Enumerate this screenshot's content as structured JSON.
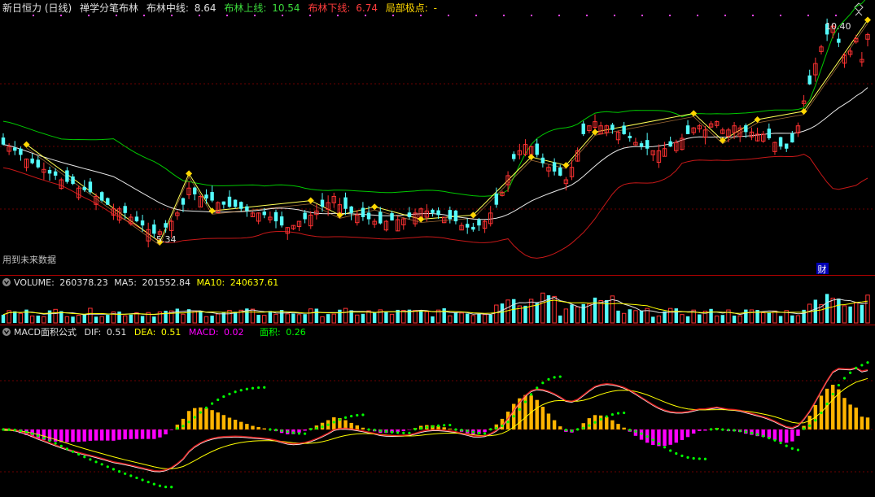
{
  "header": {
    "stock_name": "新日恒力",
    "period": "(日线)",
    "indicator_name": "禅学分笔布林",
    "mid_label": "布林中线:",
    "mid_value": "8.64",
    "upper_label": "布林上线:",
    "upper_value": "10.54",
    "lower_label": "布林下线:",
    "lower_value": "6.74",
    "extreme_label": "局部极点:",
    "extreme_value": "-"
  },
  "main_panel": {
    "future_data_note": "用到未来数据",
    "finance_marker": "财",
    "high_label": "10.40",
    "low_label": "5.34"
  },
  "volume_panel": {
    "name": "VOLUME:",
    "value": "260378.23",
    "ma5_label": "MA5:",
    "ma5_value": "201552.84",
    "ma10_label": "MA10:",
    "ma10_value": "240637.61"
  },
  "macd_panel": {
    "name": "MACD面积公式",
    "dif_label": "DIF:",
    "dif_value": "0.51",
    "dea_label": "DEA:",
    "dea_value": "0.51",
    "macd_label": "MACD:",
    "macd_value": "0.02",
    "area_label": "面积:",
    "area_value": "0.26"
  },
  "colors": {
    "background": "#000000",
    "up": "#ff3232",
    "down": "#54fcfc",
    "boll_upper": "#00c800",
    "boll_lower": "#c81818",
    "boll_mid": "#e8e8e8",
    "zigzag": "#ffff55",
    "pivot": "#ffd700",
    "grid": "#8b0000",
    "macd_pos": "#ffb400",
    "macd_neg": "#ff00ff",
    "area_dot": "#00ff00",
    "dif": "#ffffff",
    "dea": "#ffff00"
  },
  "chart_data": {
    "type": "candlestick",
    "y_range": [
      4.8,
      10.6
    ],
    "high": 10.4,
    "low": 5.34,
    "series": [
      {
        "name": "布林中线",
        "last": 8.64
      },
      {
        "name": "布林上线",
        "last": 10.54
      },
      {
        "name": "布林下线",
        "last": 6.74
      },
      {
        "name": "VOLUME",
        "last": 260378.23
      },
      {
        "name": "MA5",
        "last": 201552.84
      },
      {
        "name": "MA10",
        "last": 240637.61
      },
      {
        "name": "DIF",
        "last": 0.51
      },
      {
        "name": "DEA",
        "last": 0.51
      },
      {
        "name": "MACD",
        "last": 0.02
      },
      {
        "name": "面积",
        "last": 0.26
      }
    ],
    "closes": [
      7.55,
      7.5,
      7.4,
      7.3,
      7.2,
      7.1,
      7.0,
      6.95,
      6.85,
      6.8,
      6.7,
      6.65,
      6.6,
      6.5,
      6.45,
      6.4,
      6.3,
      6.2,
      6.1,
      6.0,
      6.0,
      5.9,
      5.8,
      5.7,
      5.6,
      5.5,
      5.4,
      5.45,
      5.55,
      5.7,
      5.9,
      6.1,
      6.5,
      6.35,
      6.3,
      6.25,
      6.2,
      6.15,
      6.1,
      6.05,
      6.05,
      6.0,
      5.95,
      5.9,
      5.9,
      5.85,
      5.8,
      5.7,
      5.6,
      5.55,
      5.6,
      5.7,
      5.75,
      5.85,
      5.95,
      6.05,
      6.15,
      6.3,
      6.1,
      6.0,
      5.9,
      5.85,
      5.8,
      5.75,
      5.7,
      5.65,
      5.7,
      5.72,
      5.74,
      5.76,
      5.8,
      5.9,
      6.0,
      5.95,
      5.9,
      5.85,
      5.8,
      5.75,
      5.7,
      5.6,
      5.55,
      5.5,
      5.6,
      5.7,
      5.9,
      6.1,
      6.4,
      6.8,
      7.2,
      7.4,
      7.55,
      7.5,
      7.3,
      7.1,
      7.0,
      6.9,
      6.8,
      6.7,
      7.0,
      7.4,
      7.8,
      8.0,
      8.1,
      8.0,
      8.0,
      7.9,
      7.85,
      7.8,
      7.7,
      7.6,
      7.5,
      7.45,
      7.4,
      7.4,
      7.45,
      7.5,
      7.6,
      7.7,
      7.8,
      7.95,
      8.0,
      7.9,
      8.05,
      8.1,
      7.9,
      7.9,
      8.0,
      7.95,
      7.85,
      7.85,
      7.8,
      7.8,
      7.7,
      7.6,
      7.5,
      7.45,
      7.6,
      8.0,
      8.6,
      9.0,
      9.5,
      9.9,
      10.2,
      10.4,
      10.0,
      9.7,
      9.8,
      10.1,
      9.6,
      10.2
    ]
  }
}
